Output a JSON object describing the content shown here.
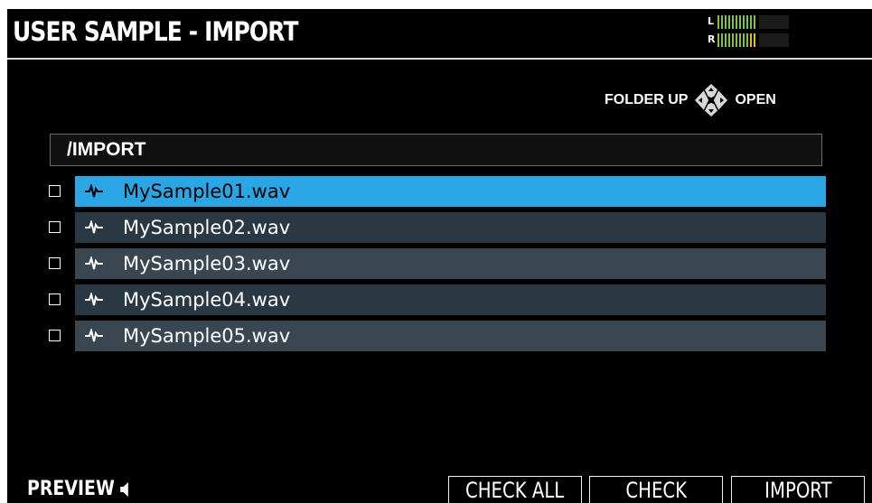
{
  "header": {
    "title": "USER SAMPLE - IMPORT",
    "meter": {
      "left_label": "L",
      "right_label": "R",
      "left_level": 0.6,
      "right_level": 0.65
    }
  },
  "nav_hint": {
    "folder_up": "FOLDER UP",
    "open": "OPEN",
    "icon": "cursor-pad-icon"
  },
  "path": "/IMPORT",
  "files": [
    {
      "name": "MySample01.wav",
      "checked": false,
      "selected": true
    },
    {
      "name": "MySample02.wav",
      "checked": false,
      "selected": false
    },
    {
      "name": "MySample03.wav",
      "checked": false,
      "selected": false
    },
    {
      "name": "MySample04.wav",
      "checked": false,
      "selected": false
    },
    {
      "name": "MySample05.wav",
      "checked": false,
      "selected": false
    }
  ],
  "footer": {
    "preview_label": "PREVIEW",
    "preview_icon": "speaker-icon",
    "buttons": {
      "check_all": "CHECK ALL",
      "check": "CHECK",
      "import": "IMPORT"
    }
  },
  "colors": {
    "selected": "#2aa6e5",
    "row_dark": "#2a3844",
    "row_light": "#3a4750",
    "meter_green": "#7cc540",
    "meter_yellow": "#e6c20a"
  }
}
